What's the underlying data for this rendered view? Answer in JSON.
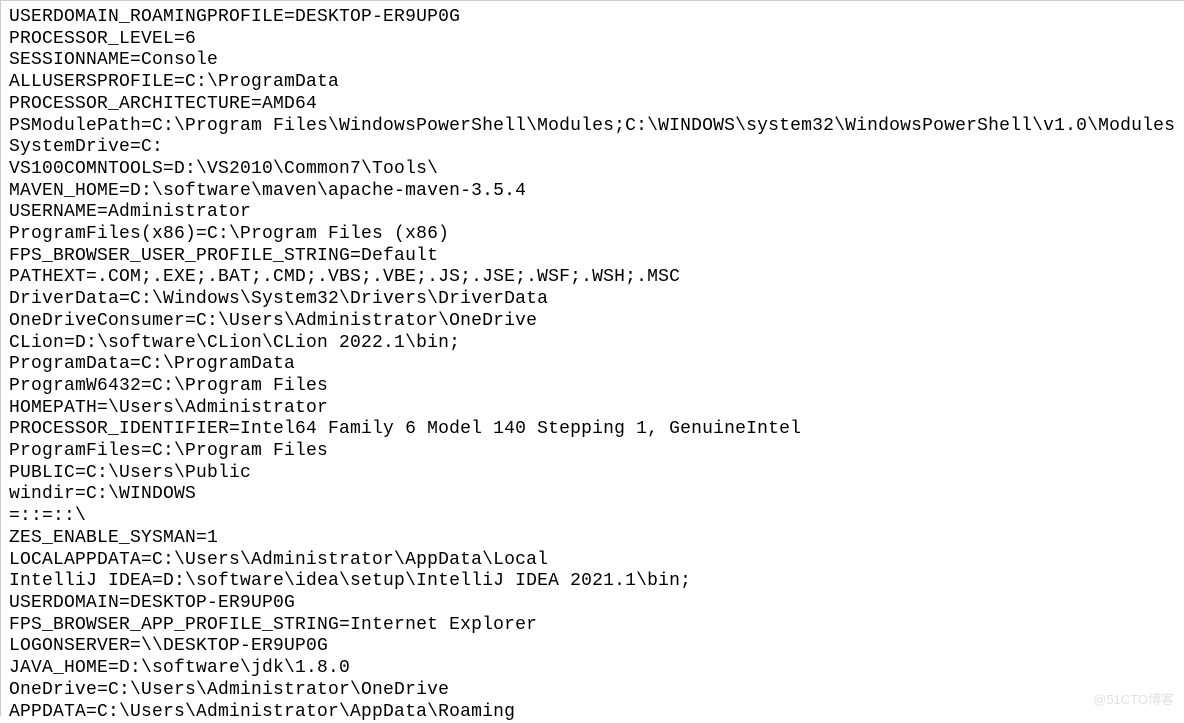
{
  "env_vars": [
    "USERDOMAIN_ROAMINGPROFILE=DESKTOP-ER9UP0G",
    "PROCESSOR_LEVEL=6",
    "SESSIONNAME=Console",
    "ALLUSERSPROFILE=C:\\ProgramData",
    "PROCESSOR_ARCHITECTURE=AMD64",
    "PSModulePath=C:\\Program Files\\WindowsPowerShell\\Modules;C:\\WINDOWS\\system32\\WindowsPowerShell\\v1.0\\Modules",
    "SystemDrive=C:",
    "VS100COMNTOOLS=D:\\VS2010\\Common7\\Tools\\",
    "MAVEN_HOME=D:\\software\\maven\\apache-maven-3.5.4",
    "USERNAME=Administrator",
    "ProgramFiles(x86)=C:\\Program Files (x86)",
    "FPS_BROWSER_USER_PROFILE_STRING=Default",
    "PATHEXT=.COM;.EXE;.BAT;.CMD;.VBS;.VBE;.JS;.JSE;.WSF;.WSH;.MSC",
    "DriverData=C:\\Windows\\System32\\Drivers\\DriverData",
    "OneDriveConsumer=C:\\Users\\Administrator\\OneDrive",
    "CLion=D:\\software\\CLion\\CLion 2022.1\\bin;",
    "ProgramData=C:\\ProgramData",
    "ProgramW6432=C:\\Program Files",
    "HOMEPATH=\\Users\\Administrator",
    "PROCESSOR_IDENTIFIER=Intel64 Family 6 Model 140 Stepping 1, GenuineIntel",
    "ProgramFiles=C:\\Program Files",
    "PUBLIC=C:\\Users\\Public",
    "windir=C:\\WINDOWS",
    "=::=::\\",
    "ZES_ENABLE_SYSMAN=1",
    "LOCALAPPDATA=C:\\Users\\Administrator\\AppData\\Local",
    "IntelliJ IDEA=D:\\software\\idea\\setup\\IntelliJ IDEA 2021.1\\bin;",
    "USERDOMAIN=DESKTOP-ER9UP0G",
    "FPS_BROWSER_APP_PROFILE_STRING=Internet Explorer",
    "LOGONSERVER=\\\\DESKTOP-ER9UP0G",
    "JAVA_HOME=D:\\software\\jdk\\1.8.0",
    "OneDrive=C:\\Users\\Administrator\\OneDrive",
    "APPDATA=C:\\Users\\Administrator\\AppData\\Roaming"
  ],
  "watermark": "@51CTO博客"
}
